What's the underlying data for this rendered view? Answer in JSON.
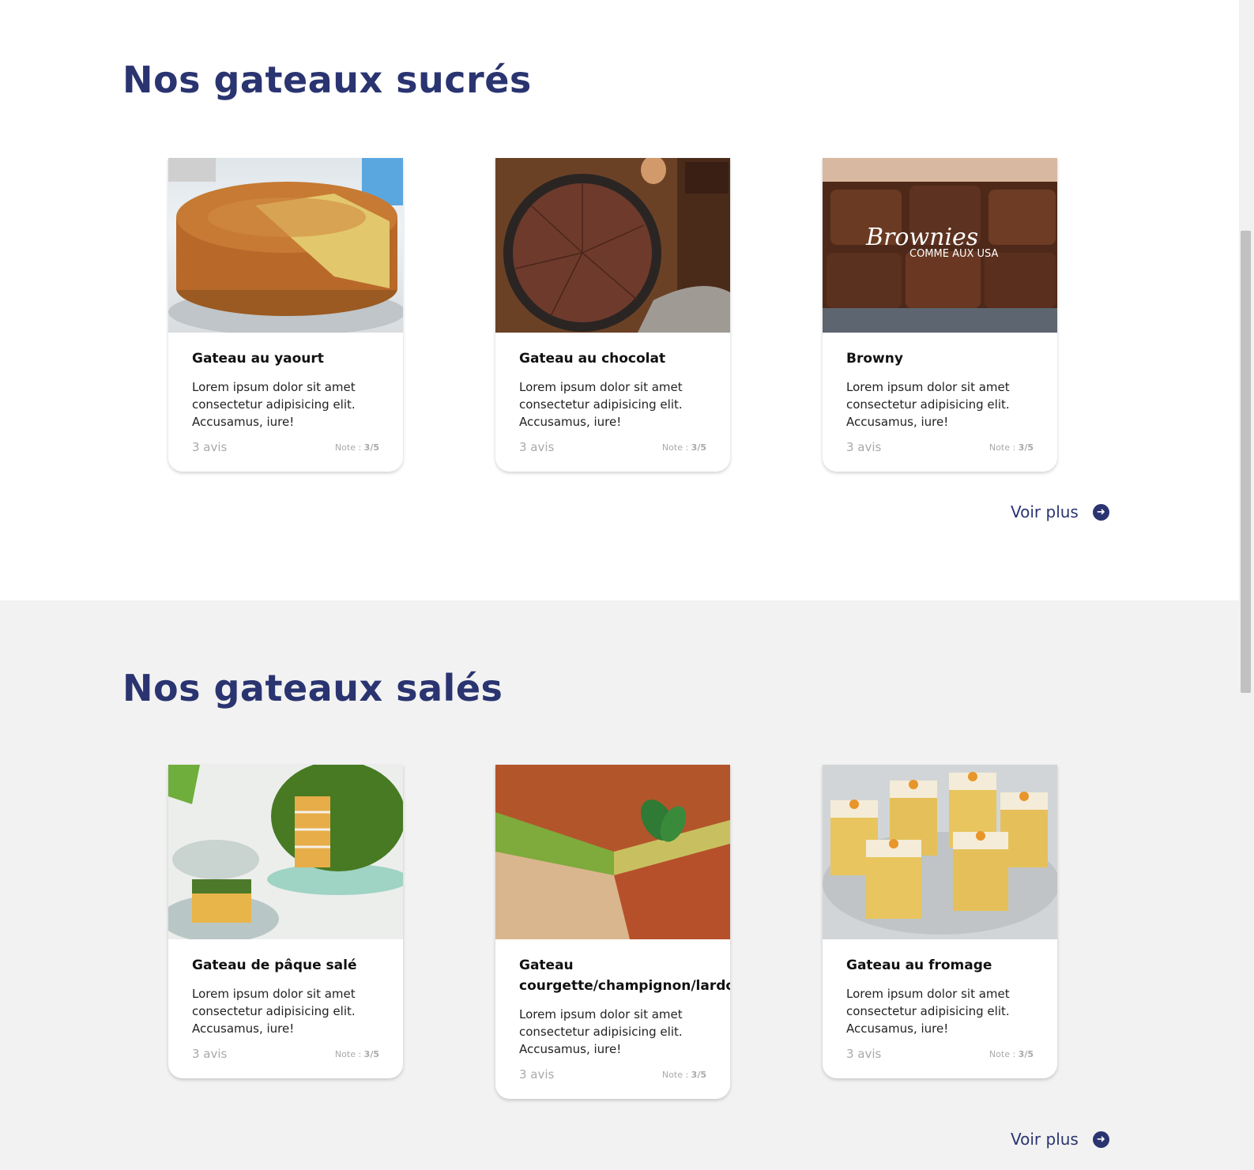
{
  "sections": [
    {
      "title": "Nos gateaux sucrés",
      "more_label": "Voir plus",
      "cards": [
        {
          "name": "Gateau au yaourt",
          "desc": "Lorem ipsum dolor sit amet consectetur adipisicing elit. Accusamus, iure!",
          "reviews": "3 avis",
          "note_label": "Note : ",
          "note_value": "3/5"
        },
        {
          "name": "Gateau au chocolat",
          "desc": "Lorem ipsum dolor sit amet consectetur adipisicing elit. Accusamus, iure!",
          "reviews": "3 avis",
          "note_label": "Note : ",
          "note_value": "3/5"
        },
        {
          "name": "Browny",
          "desc": "Lorem ipsum dolor sit amet consectetur adipisicing elit. Accusamus, iure!",
          "reviews": "3 avis",
          "note_label": "Note : ",
          "note_value": "3/5",
          "image_caption_1": "Brownies",
          "image_caption_2": "COMME AUX USA"
        }
      ]
    },
    {
      "title": "Nos gateaux salés",
      "more_label": "Voir plus",
      "cards": [
        {
          "name": "Gateau de pâque salé",
          "desc": "Lorem ipsum dolor sit amet consectetur adipisicing elit. Accusamus, iure!",
          "reviews": "3 avis",
          "note_label": "Note : ",
          "note_value": "3/5"
        },
        {
          "name": "Gateau courgette/champignon/lardon",
          "desc": "Lorem ipsum dolor sit amet consectetur adipisicing elit. Accusamus, iure!",
          "reviews": "3 avis",
          "note_label": "Note : ",
          "note_value": "3/5"
        },
        {
          "name": "Gateau au fromage",
          "desc": "Lorem ipsum dolor sit amet consectetur adipisicing elit. Accusamus, iure!",
          "reviews": "3 avis",
          "note_label": "Note : ",
          "note_value": "3/5"
        }
      ]
    }
  ],
  "icons": {
    "more": "arrow-right-circle-icon"
  },
  "colors": {
    "title": "#2a3470",
    "muted": "#a9a9a9",
    "savory_bg": "#f2f2f2",
    "topline": "#2e6b2a"
  }
}
